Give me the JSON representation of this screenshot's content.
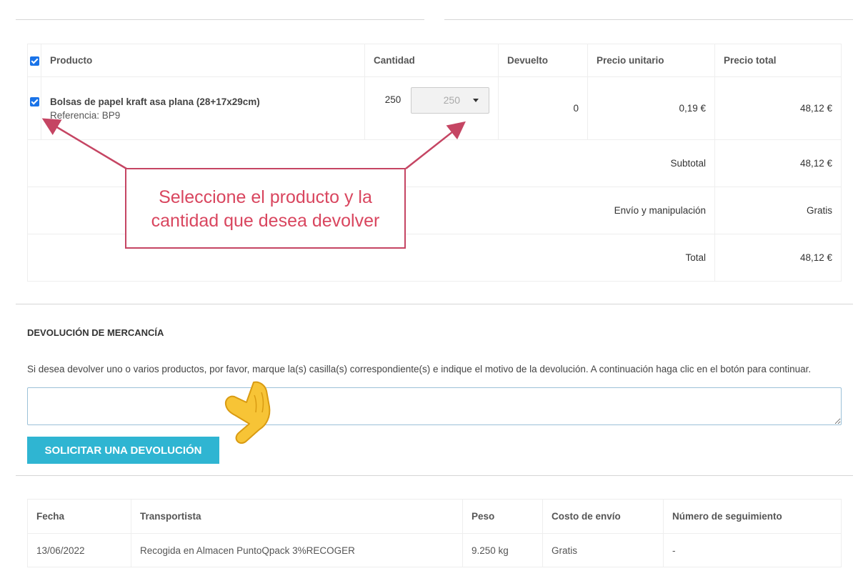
{
  "order": {
    "headers": {
      "product": "Producto",
      "quantity": "Cantidad",
      "returned": "Devuelto",
      "unit_price": "Precio unitario",
      "total_price": "Precio total"
    },
    "row": {
      "name": "Bolsas de papel kraft asa plana (28+17x29cm)",
      "reference": "Referencia: BP9",
      "quantity": "250",
      "return_qty_selected": "250",
      "returned": "0",
      "unit_price": "0,19 €",
      "total_price": "48,12 €"
    },
    "subtotal_label": "Subtotal",
    "subtotal": "48,12 €",
    "shipping_label": "Envío y manipulación",
    "shipping": "Gratis",
    "total_label": "Total",
    "total": "48,12 €"
  },
  "callout": {
    "line1": "Seleccione el producto y la",
    "line2": "cantidad que desea devolver"
  },
  "return_section": {
    "title": "DEVOLUCIÓN DE MERCANCÍA",
    "description": "Si desea devolver uno o varios productos, por favor, marque la(s) casilla(s) correspondiente(s) e indique el motivo de la devolución. A continuación haga clic en el botón para continuar.",
    "button": "SOLICITAR UNA DEVOLUCIÓN"
  },
  "shipping_table": {
    "headers": {
      "date": "Fecha",
      "carrier": "Transportista",
      "weight": "Peso",
      "cost": "Costo de envío",
      "tracking": "Número de seguimiento"
    },
    "row": {
      "date": "13/06/2022",
      "carrier": "Recogida en Almacen PuntoQpack 3%RECOGER",
      "weight": "9.250 kg",
      "cost": "Gratis",
      "tracking": "-"
    }
  },
  "colors": {
    "accent": "#2fb5d2",
    "callout": "#d9465f",
    "checkbox": "#1a73e8"
  }
}
